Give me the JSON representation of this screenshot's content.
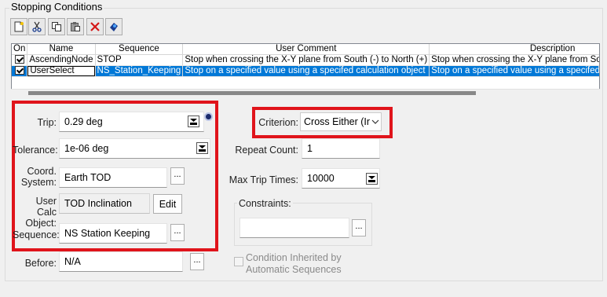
{
  "group_title": "Stopping Conditions",
  "toolbar": {
    "buttons": [
      {
        "icon": "new-icon"
      },
      {
        "icon": "cut-icon"
      },
      {
        "icon": "copy-icon"
      },
      {
        "icon": "paste-icon"
      },
      {
        "icon": "delete-icon"
      },
      {
        "icon": "properties-icon"
      }
    ]
  },
  "table": {
    "columns": [
      "On",
      "Name",
      "Sequence",
      "User Comment",
      "Description"
    ],
    "rows": [
      {
        "on": true,
        "name": "AscendingNode",
        "sequence": "STOP",
        "comment": "Stop when crossing the X-Y plane from South (-) to North (+)",
        "description": "Stop when crossing the X-Y plane from South (-) to North (+)",
        "selected": false
      },
      {
        "on": true,
        "name": "UserSelect",
        "sequence": "NS_Station_Keeping",
        "comment": "Stop on a specified value using a specifed calculation object",
        "description": "Stop on a specified value using a specifed calculation object",
        "selected": true
      }
    ]
  },
  "fields": {
    "trip_label": "Trip:",
    "trip_value": "0.29 deg",
    "tolerance_label": "Tolerance:",
    "tolerance_value": "1e-06 deg",
    "coord_label_1": "Coord.",
    "coord_label_2": "System:",
    "coord_value": "Earth TOD",
    "calc_label_1": "User Calc",
    "calc_label_2": "Object:",
    "calc_value": "TOD Inclination",
    "edit_label": "Edit",
    "sequence_label": "Sequence:",
    "sequence_value": "NS Station Keeping",
    "before_label": "Before:",
    "before_value": "N/A",
    "criterion_label": "Criterion:",
    "criterion_value": "Cross Either (Inc",
    "repeat_label": "Repeat Count:",
    "repeat_value": "1",
    "max_trip_label": "Max Trip Times:",
    "max_trip_value": "10000",
    "constraints_label": "Constraints:",
    "constraints_value": "",
    "inherited_label_1": "Condition Inherited by",
    "inherited_label_2": "Automatic Sequences",
    "dots": "..."
  },
  "colors": {
    "highlight_box": "#e0141b",
    "selection": "#0078d7"
  }
}
